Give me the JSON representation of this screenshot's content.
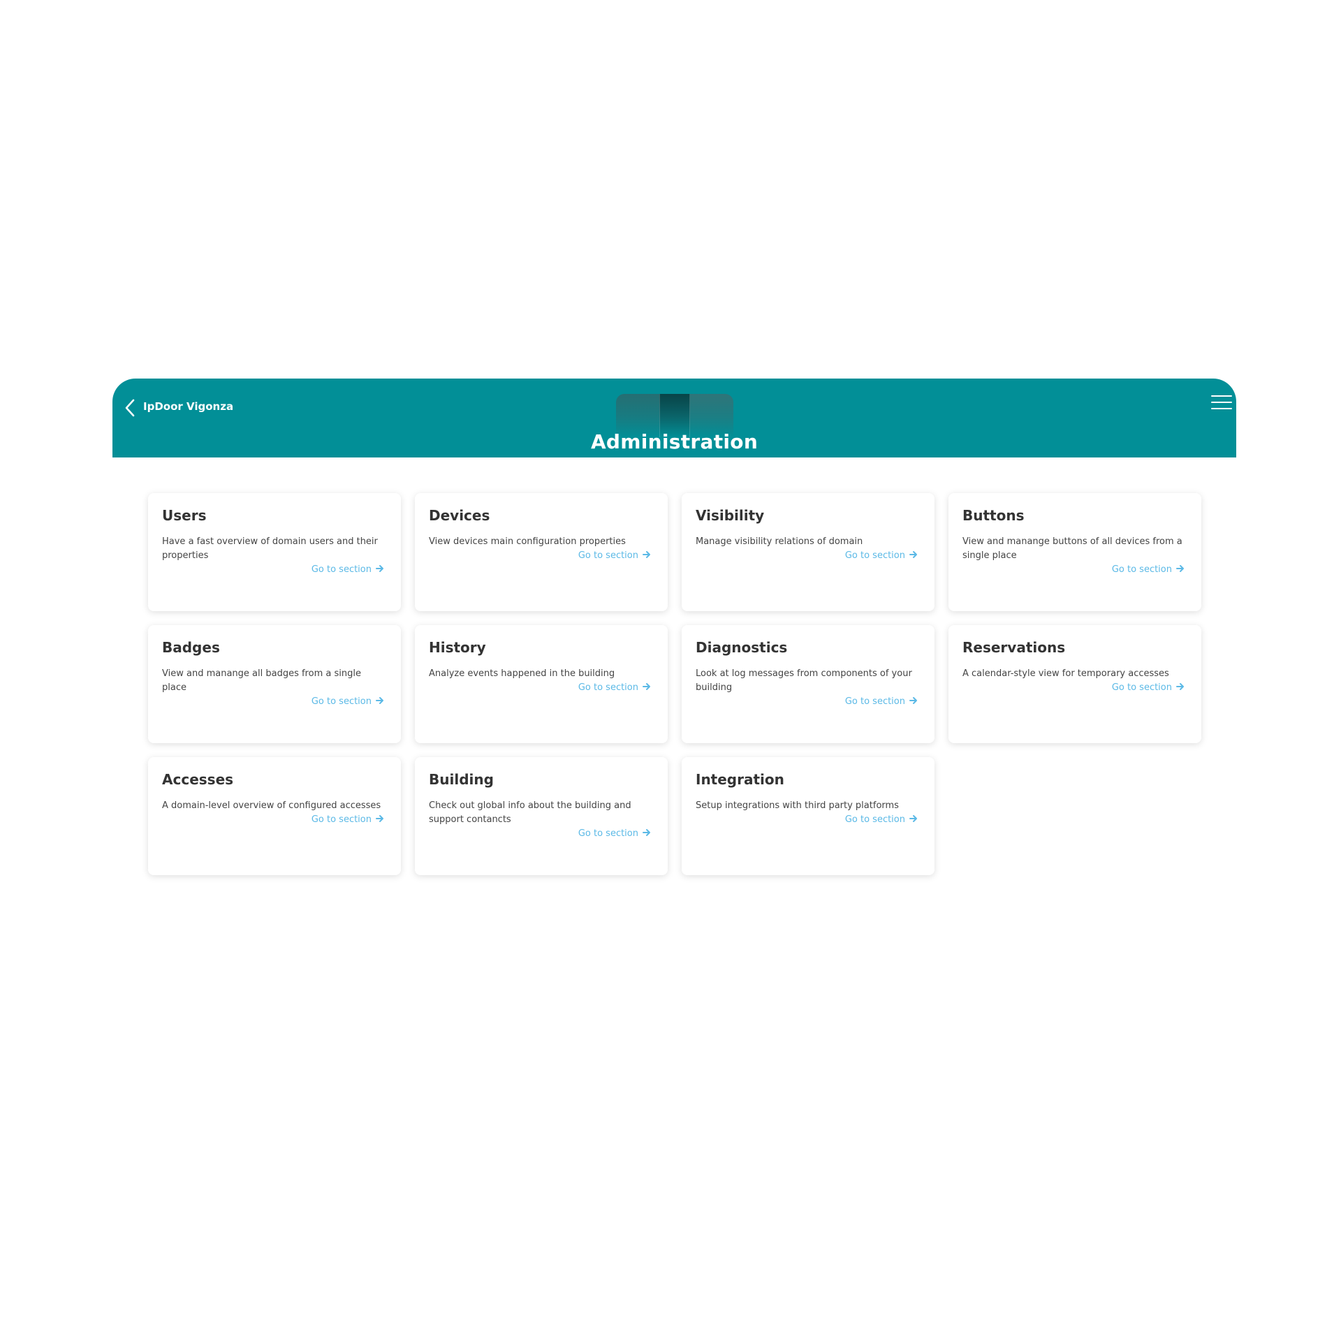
{
  "header": {
    "back_icon": "chevron-left-icon",
    "site_name": "IpDoor Vigonza",
    "title": "Administration",
    "menu_icon": "hamburger-menu-icon",
    "background_color": "#028f97"
  },
  "link_color": "#5bb9e6",
  "cards": [
    {
      "title": "Users",
      "description": "Have a fast overview of domain users and their properties",
      "link": "Go to section"
    },
    {
      "title": "Devices",
      "description": "View devices main configuration properties",
      "link": "Go to section"
    },
    {
      "title": "Visibility",
      "description": "Manage visibility relations of domain",
      "link": "Go to section"
    },
    {
      "title": "Buttons",
      "description": "View and manange buttons of all devices from a single place",
      "link": "Go to section"
    },
    {
      "title": "Badges",
      "description": "View and manange all badges from a single place",
      "link": "Go to section"
    },
    {
      "title": "History",
      "description": "Analyze events happened in the building",
      "link": "Go to section"
    },
    {
      "title": "Diagnostics",
      "description": "Look at log messages from components of your building",
      "link": "Go to section"
    },
    {
      "title": "Reservations",
      "description": "A calendar-style view for temporary accesses",
      "link": "Go to section"
    },
    {
      "title": "Accesses",
      "description": "A domain-level overview of configured accesses",
      "link": "Go to section"
    },
    {
      "title": "Building",
      "description": "Check out global info about the building and support contancts",
      "link": "Go to section"
    },
    {
      "title": "Integration",
      "description": "Setup integrations with third party platforms",
      "link": "Go to section"
    }
  ]
}
